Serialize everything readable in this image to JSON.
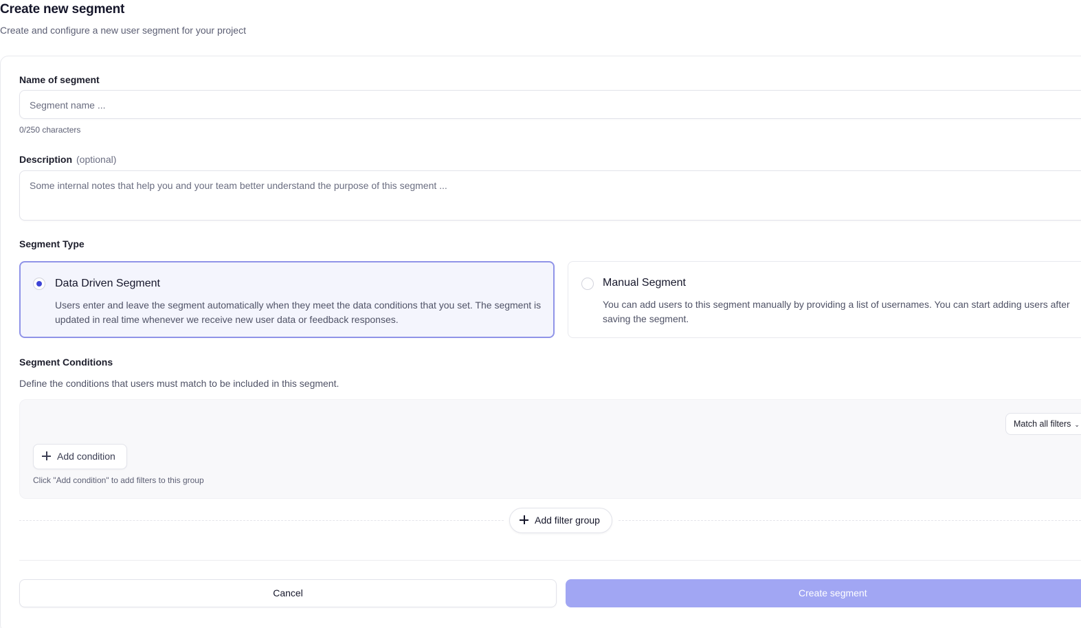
{
  "header": {
    "title": "Create new segment",
    "subtitle": "Create and configure a new user segment for your project"
  },
  "form": {
    "name": {
      "label": "Name of segment",
      "placeholder": "Segment name ...",
      "value": "",
      "char_count": "0/250 characters"
    },
    "description": {
      "label": "Description",
      "optional": "(optional)",
      "placeholder": "Some internal notes that help you and your team better understand the purpose of this segment ...",
      "value": ""
    },
    "segment_type": {
      "label": "Segment Type",
      "selected": "data_driven",
      "options": [
        {
          "title": "Data Driven Segment",
          "description": "Users enter and leave the segment automatically when they meet the data conditions that you set. The segment is updated in real time whenever we receive new user data or feedback responses."
        },
        {
          "title": "Manual Segment",
          "description": "You can add users to this segment manually by providing a list of usernames. You can start adding users after saving the segment."
        }
      ]
    },
    "conditions": {
      "label": "Segment Conditions",
      "description": "Define the conditions that users must match to be included in this segment.",
      "match_select": "Match all filters",
      "add_condition": "Add condition",
      "group_hint": "Click \"Add condition\" to add filters to this group",
      "add_filter_group": "Add filter group"
    }
  },
  "actions": {
    "cancel": "Cancel",
    "create": "Create segment"
  },
  "colors": {
    "accent": "#3e44d6",
    "create_button": "#a1a6f3",
    "selected_card_bg": "#f4f5fd",
    "selected_card_border": "#8f93e8"
  }
}
